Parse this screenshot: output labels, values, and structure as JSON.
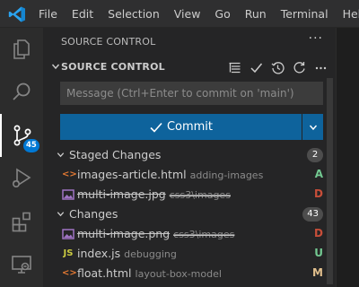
{
  "menu": [
    "File",
    "Edit",
    "Selection",
    "View",
    "Go",
    "Run",
    "Terminal",
    "Help"
  ],
  "activity_bar": {
    "items": [
      {
        "icon": "explorer-icon"
      },
      {
        "icon": "search-icon"
      },
      {
        "icon": "source-control-icon",
        "badge": "45",
        "active": true
      },
      {
        "icon": "run-debug-icon"
      },
      {
        "icon": "extensions-icon"
      },
      {
        "icon": "remote-explorer-icon"
      }
    ]
  },
  "sidebar": {
    "title": "SOURCE CONTROL",
    "more": "···",
    "repo_title": "SOURCE CONTROL",
    "message_placeholder": "Message (Ctrl+Enter to commit on 'main')",
    "commit_label": "Commit",
    "groups": {
      "staged": {
        "label": "Staged Changes",
        "count": "2",
        "files": [
          {
            "name": "images-article.html",
            "dir": "adding-images",
            "status": "A",
            "type": "html",
            "deleted": false
          },
          {
            "name": "multi-image.jpg",
            "dir": "css3\\images",
            "status": "D",
            "type": "image",
            "deleted": true
          }
        ]
      },
      "changes": {
        "label": "Changes",
        "count": "43",
        "files": [
          {
            "name": "multi-image.png",
            "dir": "css3\\images",
            "status": "D",
            "type": "image",
            "deleted": true
          },
          {
            "name": "index.js",
            "dir": "debugging",
            "status": "U",
            "type": "js",
            "deleted": false
          },
          {
            "name": "float.html",
            "dir": "layout-box-model",
            "status": "M",
            "type": "html",
            "deleted": false
          }
        ]
      }
    }
  },
  "colors": {
    "added": "#73c991",
    "deleted": "#c74e39",
    "untracked": "#73c991",
    "modified": "#e2c08d",
    "accent": "#0e639c",
    "badge": "#0078d4"
  }
}
